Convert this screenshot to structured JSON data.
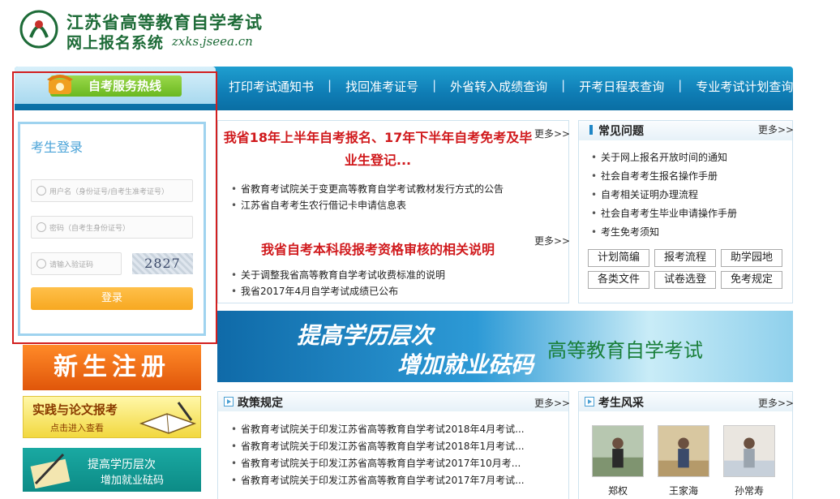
{
  "header": {
    "title": "江苏省高等教育自学考试",
    "subtitle": "网上报名系统",
    "url": "zxks.jseea.cn"
  },
  "nav": {
    "hotline": "自考服务热线",
    "links": [
      "打印考试通知书",
      "找回准考证号",
      "外省转入成绩查询",
      "开考日程表查询",
      "专业考试计划查询"
    ],
    "separator": "|"
  },
  "login": {
    "title": "考生登录",
    "username_placeholder": "用户名（身份证号/自考生准考证号）",
    "password_placeholder": "密码（自考生身份证号）",
    "captcha_placeholder": "请输入验证码",
    "captcha_code": "2827",
    "submit_label": "登录"
  },
  "left_banners": {
    "register": "新生注册",
    "practice_title": "实践与论文报考",
    "practice_sub": "点击进入查看",
    "edu_line1": "提高学历层次",
    "edu_line2": "增加就业砝码"
  },
  "news": {
    "headline1": "我省18年上半年自考报名、17年下半年自考免考及毕业生登记...",
    "headline2": "我省自考本科段报考资格审核的相关说明",
    "more": "更多>>",
    "items1": [
      "省教育考试院关于变更高等教育自学考试教材发行方式的公告",
      "江苏省自考考生农行借记卡申请信息表"
    ],
    "items2": [
      "关于调整我省高等教育自学考试收费标准的说明",
      "我省2017年4月自学考试成绩已公布"
    ]
  },
  "faq": {
    "title": "常见问题",
    "more": "更多>>",
    "items": [
      "关于网上报名开放时间的通知",
      "社会自考考生报名操作手册",
      "自考相关证明办理流程",
      "社会自考考生毕业申请操作手册",
      "考生免考须知"
    ],
    "buttons": [
      "计划简编",
      "报考流程",
      "助学园地",
      "各类文件",
      "试卷选登",
      "免考规定"
    ]
  },
  "big_banner": {
    "line1": "提高学历层次",
    "line2": "增加就业砝码",
    "right": "高等教育自学考试"
  },
  "policy": {
    "title": "政策规定",
    "more": "更多>>",
    "items": [
      "省教育考试院关于印发江苏省高等教育自学考试2018年4月考试...",
      "省教育考试院关于印发江苏省高等教育自学考试2018年1月考试...",
      "省教育考试院关于印发江苏省高等教育自学考试2017年10月考...",
      "省教育考试院关于印发江苏省高等教育自学考试2017年7月考试..."
    ]
  },
  "students": {
    "title": "考生风采",
    "more": "更多>>",
    "names": [
      "郑权",
      "王家海",
      "孙常寿"
    ]
  }
}
